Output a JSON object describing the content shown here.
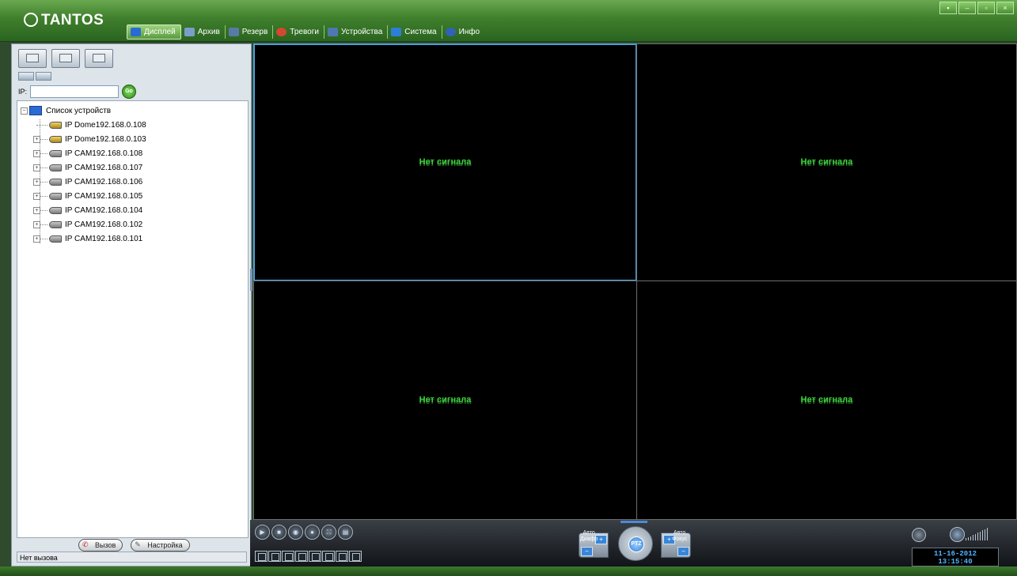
{
  "app": {
    "logo": "TANTOS"
  },
  "menu": [
    {
      "label": "Дисплей",
      "icon": "display-icon",
      "active": true,
      "color": "#2a6ad4"
    },
    {
      "label": "Архив",
      "icon": "archive-icon",
      "active": false,
      "color": "#7a9ec9"
    },
    {
      "label": "Резерв",
      "icon": "backup-icon",
      "active": false,
      "color": "#5a7aa6"
    },
    {
      "label": "Тревоги",
      "icon": "alarm-icon",
      "active": false,
      "color": "#d6472f"
    },
    {
      "label": "Устройства",
      "icon": "devices-icon",
      "active": false,
      "color": "#4f78b0"
    },
    {
      "label": "Система",
      "icon": "system-icon",
      "active": false,
      "color": "#2b7fd6"
    },
    {
      "label": "Инфо",
      "icon": "info-icon",
      "active": false,
      "color": "#3262b8"
    }
  ],
  "window_controls": [
    "lock-icon",
    "minimize-icon",
    "restore-icon",
    "close-icon"
  ],
  "ip_search": {
    "label": "IP:",
    "value": "",
    "go_label": "Go"
  },
  "tree": {
    "root_label": "Список устройств",
    "items": [
      {
        "label": "IP Dome192.168.0.108",
        "type": "dome"
      },
      {
        "label": "IP Dome192.168.0.103",
        "type": "dome"
      },
      {
        "label": "IP CAM192.168.0.108",
        "type": "cam"
      },
      {
        "label": "IP CAM192.168.0.107",
        "type": "cam"
      },
      {
        "label": "IP CAM192.168.0.106",
        "type": "cam"
      },
      {
        "label": "IP CAM192.168.0.105",
        "type": "cam"
      },
      {
        "label": "IP CAM192.168.0.104",
        "type": "cam"
      },
      {
        "label": "IP CAM192.168.0.102",
        "type": "cam"
      },
      {
        "label": "IP CAM192.168.0.101",
        "type": "cam"
      }
    ]
  },
  "call": {
    "call_label": "Вызов",
    "settings_label": "Настройка",
    "status": "Нет вызова"
  },
  "video": {
    "cells": [
      {
        "text": "Нет сигнала",
        "selected": true
      },
      {
        "text": "Нет сигнала",
        "selected": false
      },
      {
        "text": "Нет сигнала",
        "selected": false
      },
      {
        "text": "Нет сигнала",
        "selected": false
      }
    ]
  },
  "ptz": {
    "center_label": "PTZ",
    "iris_label_1": "Авто",
    "iris_label_2": "Диафр",
    "focus_label_1": "Авто",
    "focus_label_2": "Фокус"
  },
  "clock": {
    "date": "11-16-2012",
    "time": "13:15:40"
  },
  "accent_colors": {
    "green": "#3fcf3f",
    "selection": "#4aa3df",
    "clock": "#4fb2ff"
  }
}
